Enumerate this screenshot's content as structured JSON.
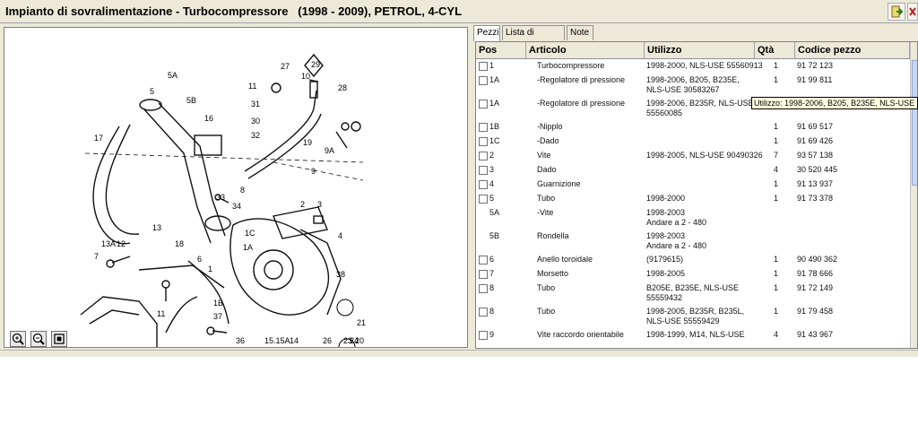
{
  "window": {
    "title": "Impianto di sovralimentazione - Turbocompressore   (1998 - 2009), PETROL, 4-CYL"
  },
  "toolbar": {
    "export_icon": "export-icon",
    "close_icon": "close-icon"
  },
  "diagram": {
    "callouts": [
      "5A",
      "5",
      "5B",
      "16",
      "17",
      "27",
      "29",
      "10",
      "28",
      "11",
      "31",
      "30",
      "32",
      "9",
      "9A",
      "19",
      "18",
      "33",
      "34",
      "13",
      "13A",
      "12",
      "7",
      "6",
      "1C",
      "1A",
      "1",
      "38",
      "1B",
      "37",
      "36",
      "15.15A",
      "14",
      "26",
      "24",
      "20",
      "21",
      "23",
      "4",
      "3",
      "2",
      "8",
      "11"
    ],
    "zoom": {
      "zoom_in_icon": "zoom-in-icon",
      "zoom_out_icon": "zoom-out-icon",
      "fit_icon": "fit-page-icon"
    }
  },
  "tabs": [
    "Pezzi",
    "Lista di selezione",
    "Note"
  ],
  "table": {
    "columns": [
      "Pos",
      "Articolo",
      "Utilizzo",
      "Qtà",
      "Codice pezzo"
    ],
    "rows": [
      {
        "pos": "1",
        "articolo": "Turbocompressore",
        "utilizzo": "1998-2000, NLS-USE 55560913",
        "qta": "1",
        "codice": "91 72 123",
        "checkbox": true
      },
      {
        "pos": "1A",
        "articolo": "-Regolatore di pressione",
        "utilizzo": "1998-2006, B205, B235E,\nNLS-USE 30583267",
        "qta": "1",
        "codice": "91 99 811",
        "checkbox": true
      },
      {
        "pos": "1A",
        "articolo": "-Regolatore di pressione",
        "utilizzo": "1998-2006, B235R, NLS-USE\n55560085",
        "qta": "",
        "codice": "",
        "checkbox": true
      },
      {
        "pos": "1B",
        "articolo": "-Nipplo",
        "utilizzo": "",
        "qta": "1",
        "codice": "91 69 517",
        "checkbox": true
      },
      {
        "pos": "1C",
        "articolo": "-Dado",
        "utilizzo": "",
        "qta": "1",
        "codice": "91 69 426",
        "checkbox": true
      },
      {
        "pos": "2",
        "articolo": "Vite",
        "utilizzo": "1998-2005, NLS-USE 90490326",
        "qta": "7",
        "codice": "93 57 138",
        "checkbox": true
      },
      {
        "pos": "3",
        "articolo": "Dado",
        "utilizzo": "",
        "qta": "4",
        "codice": "30 520 445",
        "checkbox": true
      },
      {
        "pos": "4",
        "articolo": "Guarnizione",
        "utilizzo": "",
        "qta": "1",
        "codice": "91 13 937",
        "checkbox": true
      },
      {
        "pos": "5",
        "articolo": "Tubo",
        "utilizzo": "1998-2000",
        "qta": "1",
        "codice": "91 73 378",
        "checkbox": true
      },
      {
        "pos": "5A",
        "articolo": "-Vite",
        "utilizzo": "1998-2003\nAndare a 2 - 480",
        "qta": "",
        "codice": "",
        "checkbox": false
      },
      {
        "pos": "5B",
        "articolo": "Rondella",
        "utilizzo": "1998-2003\nAndare a 2 - 480",
        "qta": "",
        "codice": "",
        "checkbox": false
      },
      {
        "pos": "6",
        "articolo": "Anello toroidale",
        "utilizzo": "(9179615)",
        "qta": "1",
        "codice": "90 490 362",
        "checkbox": true
      },
      {
        "pos": "7",
        "articolo": "Morsetto",
        "utilizzo": "1998-2005",
        "qta": "1",
        "codice": "91 78 666",
        "checkbox": true
      },
      {
        "pos": "8",
        "articolo": "Tubo",
        "utilizzo": "B205E, B235E, NLS-USE\n55559432",
        "qta": "1",
        "codice": "91 72 149",
        "checkbox": true
      },
      {
        "pos": "8",
        "articolo": "Tubo",
        "utilizzo": "1998-2005, B235R, B235L,\nNLS-USE 55559429",
        "qta": "1",
        "codice": "91 79 458",
        "checkbox": true
      },
      {
        "pos": "9",
        "articolo": "Vite raccordo orientabile",
        "utilizzo": "1998-1999, M14, NLS-USE",
        "qta": "4",
        "codice": "91 43 967",
        "checkbox": true
      }
    ]
  },
  "tooltip": {
    "text": "Utilizzo: 1998-2006, B205, B235E, NLS-USE 30583"
  }
}
